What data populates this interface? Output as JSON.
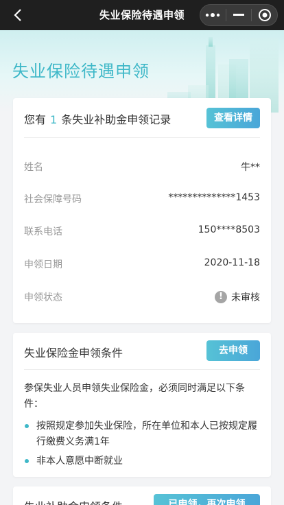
{
  "navbar": {
    "title": "失业保险待遇申领",
    "back_icon": "chevron-left-icon",
    "more_icon": "more-dots-icon",
    "minimize_icon": "minimize-icon",
    "close_icon": "target-close-icon"
  },
  "hero": {
    "title": "失业保险待遇申领"
  },
  "records": {
    "prefix": "您有",
    "count": "1",
    "suffix": "条失业补助金申领记录",
    "button": "查看详情",
    "rows": [
      {
        "label": "姓名",
        "value": "牛**"
      },
      {
        "label": "社会保障号码",
        "value": "**************1453"
      },
      {
        "label": "联系电话",
        "value": "150****8503"
      },
      {
        "label": "申领日期",
        "value": "2020-11-18"
      },
      {
        "label": "申领状态",
        "value": "未审核"
      }
    ]
  },
  "insurance_conditions": {
    "title": "失业保险金申领条件",
    "button": "去申领",
    "intro": "参保失业人员申领失业保险金，必须同时满足以下条件：",
    "items": [
      "按照规定参加失业保险，所在单位和本人已按规定履行缴费义务满1年",
      "非本人意愿中断就业"
    ]
  },
  "subsidy_conditions": {
    "title": "失业补助金申领条件",
    "button": "已申领，再次申领"
  },
  "colors": {
    "accent": "#3fb8c8",
    "button": "#4aa6d8",
    "navbar": "#1f1f1f"
  }
}
